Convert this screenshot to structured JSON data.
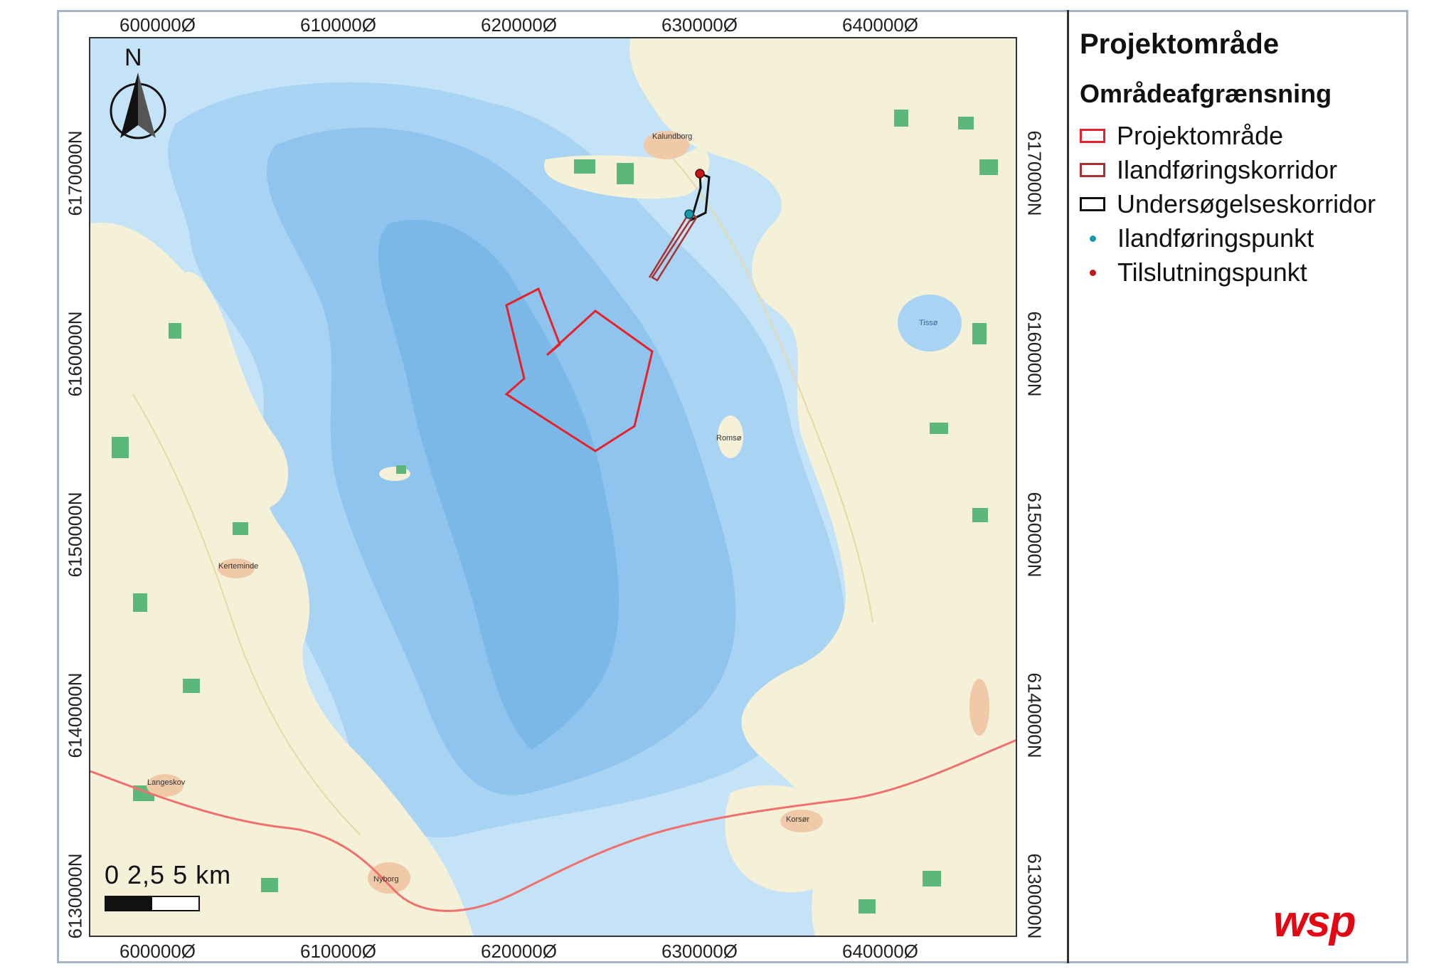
{
  "map": {
    "x_ticks": [
      "600000Ø",
      "610000Ø",
      "620000Ø",
      "630000Ø",
      "640000Ø"
    ],
    "y_ticks": [
      "6170000N",
      "6160000N",
      "6150000N",
      "6140000N",
      "6130000N"
    ],
    "north_label": "N",
    "scale_label": "0  2,5  5 km",
    "place_labels": {
      "kalundborg": "Kalundborg",
      "tisso": "Tissø",
      "nyborg": "Nyborg",
      "korsor": "Korsør",
      "kerteminde": "Kerteminde",
      "langeskov": "Langeskov",
      "omo": "Romsø"
    },
    "colors": {
      "sea_deep": "#8ec4ee",
      "sea_mid": "#a9d3f2",
      "sea_shallow": "#c4e3f7",
      "land": "#f5f0d8",
      "forest": "#5cb87a",
      "urban": "#f0c9a8",
      "motorway": "#f07070",
      "project_area": "#e8202a",
      "landfall_corridor": "#a83232",
      "survey_corridor": "#111111",
      "landfall_point": "#1a9aa8",
      "connection_point": "#c0161c"
    }
  },
  "legend": {
    "title": "Projektområde",
    "subtitle": "Områdeafgrænsning",
    "items": [
      {
        "label": "Projektområde",
        "kind": "swatch",
        "color": "#e8202a"
      },
      {
        "label": "Ilandføringskorridor",
        "kind": "swatch",
        "color": "#a83232"
      },
      {
        "label": "Undersøgelseskorridor",
        "kind": "swatch",
        "color": "#111111"
      },
      {
        "label": "Ilandføringspunkt",
        "kind": "dot",
        "color": "#1a9aa8"
      },
      {
        "label": "Tilslutningspunkt",
        "kind": "dot",
        "color": "#c0161c"
      }
    ]
  },
  "logo": "wsp"
}
